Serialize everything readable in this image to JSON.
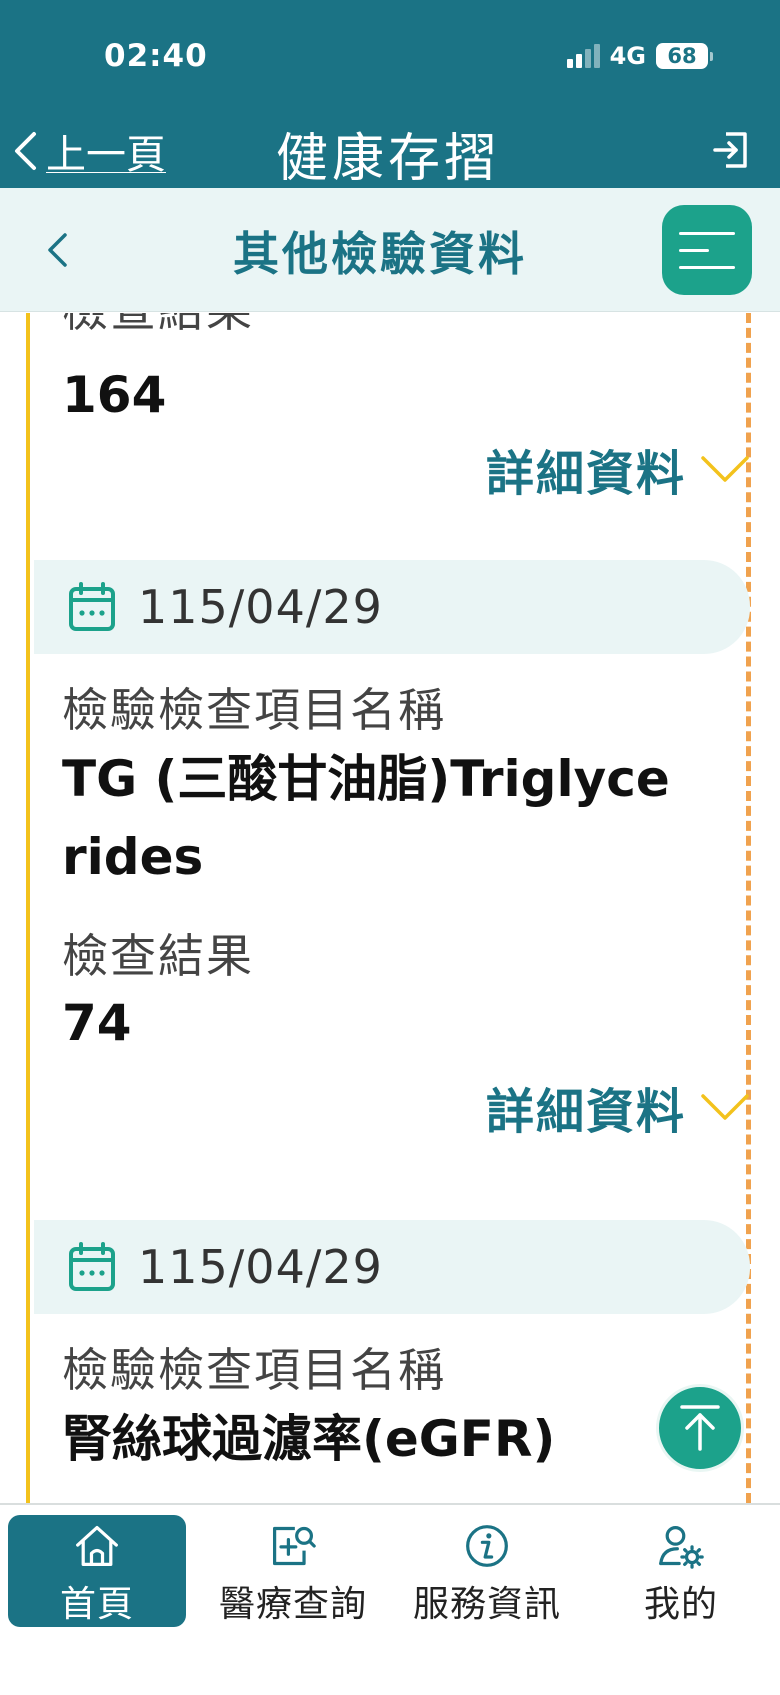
{
  "status": {
    "time": "02:40",
    "network": "4G",
    "battery": "68"
  },
  "header": {
    "back_label": "上一頁",
    "title": "健康存摺"
  },
  "subheader": {
    "title": "其他檢驗資料"
  },
  "records": [
    {
      "result_label": "檢查結果",
      "result_value": "164",
      "detail_label": "詳細資料"
    },
    {
      "date": "115/04/29",
      "item_label": "檢驗檢查項目名稱",
      "item_value_line1": "TG (三酸甘油脂)Triglyce",
      "item_value_line2": "rides",
      "result_label": "檢查結果",
      "result_value": "74",
      "detail_label": "詳細資料"
    },
    {
      "date": "115/04/29",
      "item_label": "檢驗檢查項目名稱",
      "item_value_line1": "腎絲球過濾率(eGFR)"
    }
  ],
  "tabs": [
    {
      "label": "首頁",
      "icon": "home-icon",
      "active": true
    },
    {
      "label": "醫療查詢",
      "icon": "medical-search-icon",
      "active": false
    },
    {
      "label": "服務資訊",
      "icon": "info-icon",
      "active": false
    },
    {
      "label": "我的",
      "icon": "user-settings-icon",
      "active": false
    }
  ],
  "colors": {
    "header": "#1b7385",
    "accent": "#1ca28b",
    "timeline": "#f3c21c",
    "dashed": "#f0a24e",
    "chevron": "#f3c21c"
  }
}
